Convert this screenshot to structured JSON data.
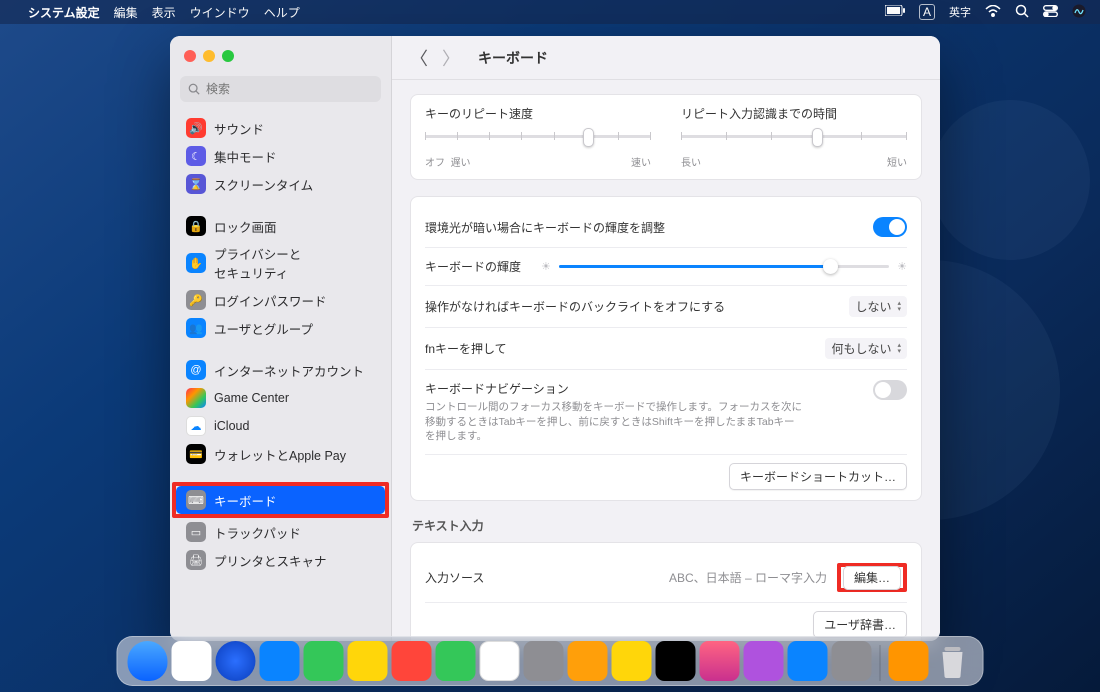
{
  "menubar": {
    "app": "システム設定",
    "items": [
      "編集",
      "表示",
      "ウインドウ",
      "ヘルプ"
    ],
    "ime": "英字",
    "imesym": "A"
  },
  "sidebar": {
    "search_placeholder": "検索",
    "groups": [
      [
        {
          "icon": "sound",
          "color": "#ff3b30",
          "label": "サウンド"
        },
        {
          "icon": "moon",
          "color": "#5e5ce6",
          "label": "集中モード"
        },
        {
          "icon": "hourglass",
          "color": "#5856d6",
          "label": "スクリーンタイム"
        }
      ],
      [
        {
          "icon": "lock",
          "color": "#000000",
          "label": "ロック画面"
        },
        {
          "icon": "hand",
          "color": "#0a84ff",
          "label": "プライバシーとセキュリティ",
          "two": "セキュリティ",
          "firstline": "プライバシーと"
        },
        {
          "icon": "key",
          "color": "#8e8e93",
          "label": "ログインパスワード"
        },
        {
          "icon": "users",
          "color": "#0a84ff",
          "label": "ユーザとグループ"
        }
      ],
      [
        {
          "icon": "at",
          "color": "#0a84ff",
          "label": "インターネットアカウント"
        },
        {
          "icon": "gc",
          "color": "#ffffff",
          "label": "Game Center"
        },
        {
          "icon": "cloud",
          "color": "#ffffff",
          "label": "iCloud"
        },
        {
          "icon": "wallet",
          "color": "#000000",
          "label": "ウォレットとApple Pay"
        }
      ],
      [
        {
          "icon": "keyboard",
          "color": "#8e8e93",
          "label": "キーボード",
          "selected": true
        },
        {
          "icon": "trackpad",
          "color": "#8e8e93",
          "label": "トラックパッド"
        },
        {
          "icon": "printer",
          "color": "#8e8e93",
          "label": "プリンタとスキャナ"
        }
      ]
    ]
  },
  "main": {
    "title": "キーボード",
    "repeat": {
      "label": "キーのリピート速度",
      "lo": "オフ",
      "lo2": "遅い",
      "hi": "速い"
    },
    "delay": {
      "label": "リピート入力認識までの時間",
      "lo": "長い",
      "hi": "短い"
    },
    "card2": {
      "row1": "環境光が暗い場合にキーボードの輝度を調整",
      "row2": "キーボードの輝度",
      "row3": "操作がなければキーボードのバックライトをオフにする",
      "row3val": "しない",
      "row4": "fnキーを押して",
      "row4val": "何もしない",
      "row5": "キーボードナビゲーション",
      "help": "コントロール間のフォーカス移動をキーボードで操作します。フォーカスを次に移動するときはTabキーを押し、前に戻すときはShiftキーを押したままTabキーを押します。",
      "shortcut_btn": "キーボードショートカット…"
    },
    "text": {
      "sectitle": "テキスト入力",
      "row1": "入力ソース",
      "row1val": "ABC、日本語 – ローマ字入力",
      "edit": "編集…",
      "dict": "ユーザ辞書…"
    }
  }
}
